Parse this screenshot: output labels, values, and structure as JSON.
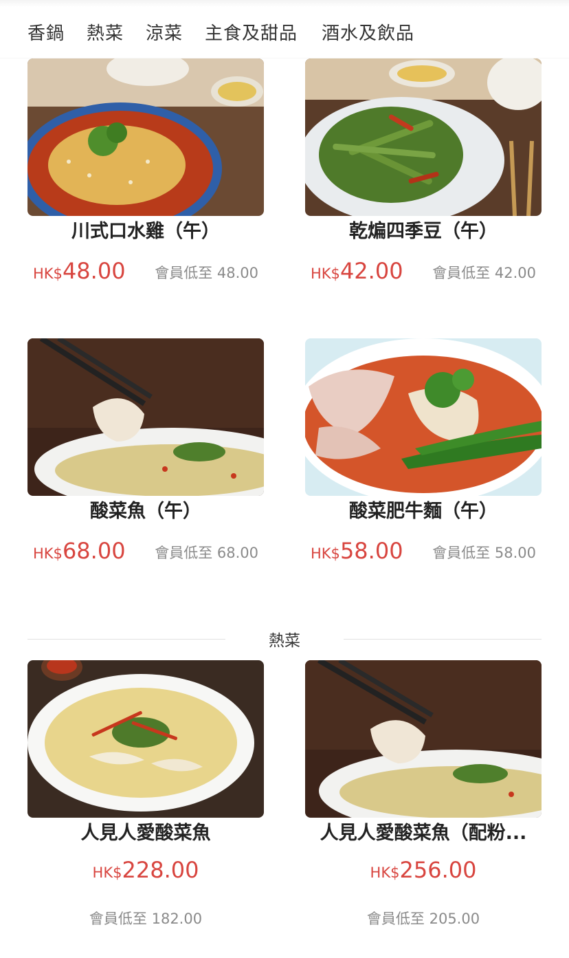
{
  "tabs": [
    "香鍋",
    "熱菜",
    "涼菜",
    "主食及甜品",
    "酒水及飲品"
  ],
  "products": [
    {
      "name": "川式口水雞（午）",
      "currency": "HK$",
      "price": "48.00",
      "member_price": "會員低至 48.00"
    },
    {
      "name": "乾煸四季豆（午）",
      "currency": "HK$",
      "price": "42.00",
      "member_price": "會員低至 42.00"
    },
    {
      "name": "酸菜魚（午）",
      "currency": "HK$",
      "price": "68.00",
      "member_price": "會員低至 68.00"
    },
    {
      "name": "酸菜肥牛麵（午）",
      "currency": "HK$",
      "price": "58.00",
      "member_price": "會員低至 58.00"
    }
  ],
  "section": {
    "title": "熱菜",
    "products": [
      {
        "name": "人見人愛酸菜魚",
        "currency": "HK$",
        "price": "228.00",
        "member_price": "會員低至 182.00"
      },
      {
        "name": "人見人愛酸菜魚（配粉...",
        "currency": "HK$",
        "price": "256.00",
        "member_price": "會員低至 205.00"
      }
    ]
  },
  "colors": {
    "price": "#d8453f",
    "member_text": "#8a8a8a",
    "divider": "#e2e2e2"
  }
}
